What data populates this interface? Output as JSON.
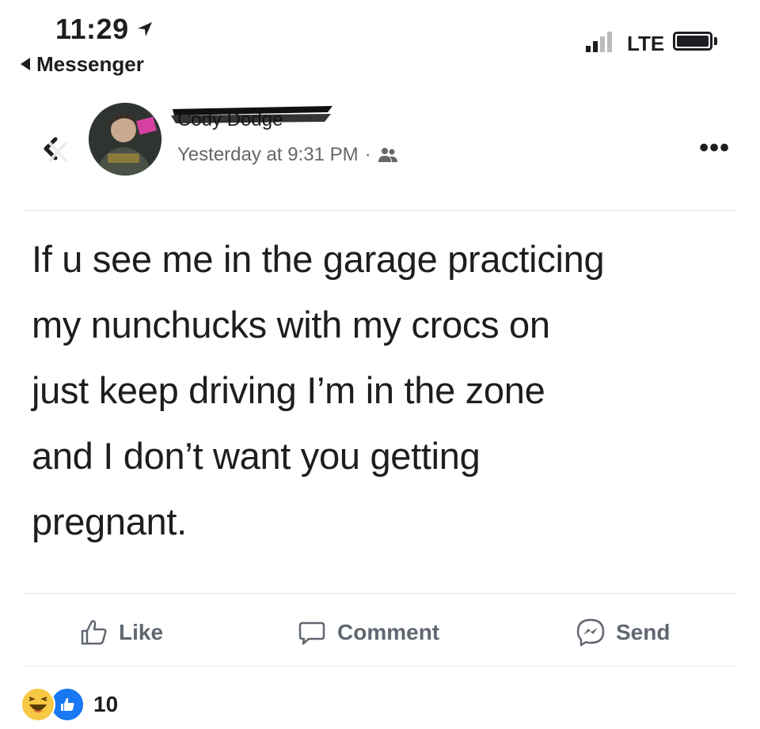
{
  "status_bar": {
    "time": "11:29",
    "back_app": "Messenger",
    "carrier": "LTE"
  },
  "post": {
    "author": "Cody Dodge",
    "timestamp": "Yesterday at 9:31 PM",
    "separator": "·",
    "privacy_icon": "friends-icon",
    "text_lines": [
      "If u see me in the garage practicing",
      "my nunchucks with my crocs on",
      "just keep driving I’m in the zone",
      "and I don’t want you getting",
      "pregnant."
    ]
  },
  "actions": {
    "like_label": "Like",
    "comment_label": "Comment",
    "send_label": "Send"
  },
  "reactions": {
    "types": [
      "haha",
      "like"
    ],
    "count": "10"
  },
  "colors": {
    "text": "#1c1e21",
    "secondary": "#65676b",
    "action": "#606770",
    "like_blue": "#1877f2",
    "haha_yellow": "#f7c843"
  }
}
